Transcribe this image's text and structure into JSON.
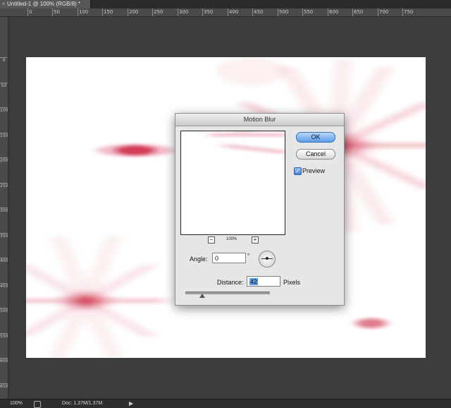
{
  "document": {
    "tab_title": "Untitled-1 @ 100% (RGB/8) *",
    "close_glyph": "×"
  },
  "rulers": {
    "horizontal": [
      "0",
      "50",
      "100",
      "150",
      "200",
      "250",
      "300",
      "350",
      "400",
      "450",
      "500",
      "550",
      "600",
      "650",
      "700",
      "750"
    ],
    "vertical": [
      "0",
      "50",
      "100",
      "150",
      "200",
      "250",
      "300",
      "350",
      "400",
      "450",
      "500",
      "550",
      "600",
      "650"
    ]
  },
  "status": {
    "zoom": "100%",
    "doc_info": "Doc: 1.37M/1.37M",
    "arrow_glyph": "▶"
  },
  "dialog": {
    "title": "Motion Blur",
    "ok_label": "OK",
    "cancel_label": "Cancel",
    "preview_label": "Preview",
    "preview_checked": true,
    "zoom_out_glyph": "−",
    "zoom_in_glyph": "+",
    "preview_zoom": "100%",
    "angle_label": "Angle:",
    "angle_value": "0",
    "angle_unit": "°",
    "distance_label": "Distance:",
    "distance_value": "42",
    "distance_unit": "Pixels",
    "distance_slider_fraction": 0.2
  },
  "colors": {
    "blur_red": "#c8102e",
    "ok_button": "#5a9be6"
  },
  "icons": [
    "close-icon",
    "checkmark-icon",
    "zoom-out-icon",
    "zoom-in-icon",
    "angle-dial-icon",
    "status-arrow-icon",
    "status-icon"
  ]
}
